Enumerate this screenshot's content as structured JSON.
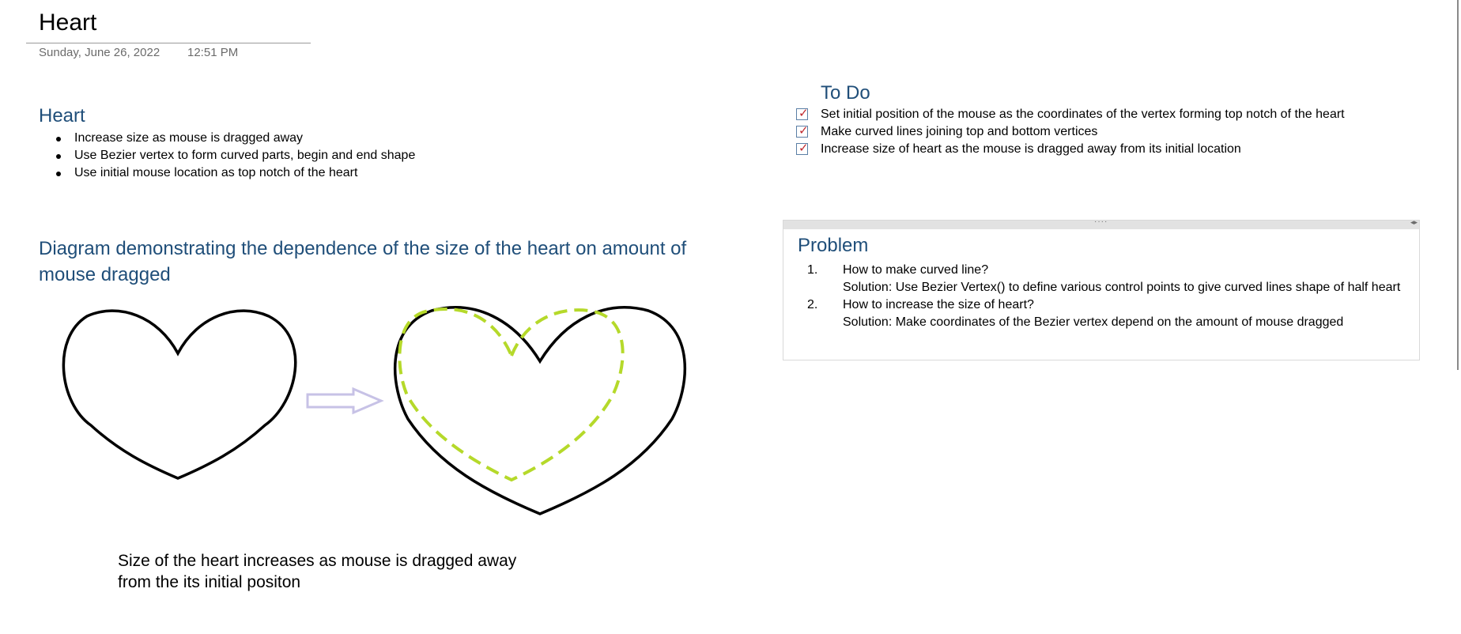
{
  "page": {
    "title": "Heart",
    "date": "Sunday, June 26, 2022",
    "time": "12:51 PM"
  },
  "heart_section": {
    "heading": "Heart",
    "bullets": [
      "Increase size as mouse is dragged away",
      "Use Bezier vertex to form curved parts, begin and end shape",
      "Use initial mouse location as top notch of the heart"
    ]
  },
  "diagram": {
    "heading": "Diagram demonstrating the dependence of the size of the heart on amount of mouse dragged",
    "caption_line1": "Size of the heart increases as mouse is dragged away",
    "caption_line2": "from the its initial positon",
    "colors": {
      "heart_stroke": "#000000",
      "dashed_heart": "#b5d92a",
      "arrow": "#c7c2e6"
    }
  },
  "todo": {
    "heading": "To Do",
    "items": [
      {
        "text": "Set initial position of the mouse as the coordinates of the vertex forming top notch of the heart",
        "checked": true
      },
      {
        "text": "Make curved lines joining top and bottom vertices",
        "checked": true
      },
      {
        "text": "Increase size of heart as the mouse is dragged away from its initial location",
        "checked": true
      }
    ],
    "check_glyph": "✓",
    "check_color": "#c0282d"
  },
  "problem": {
    "heading": "Problem",
    "grip": "····",
    "resize_arrows": "◂▸",
    "items": [
      {
        "number": "1.",
        "question": "How to make curved line?",
        "solution": "Solution: Use Bezier Vertex() to define various control points to give curved lines shape of half heart"
      },
      {
        "number": "2.",
        "question": "How to increase the size of heart?",
        "solution": "Solution: Make coordinates of the Bezier vertex depend on the amount of mouse dragged"
      }
    ]
  },
  "colors": {
    "heading_blue": "#1f4e79",
    "meta_gray": "#6b6b6b"
  }
}
